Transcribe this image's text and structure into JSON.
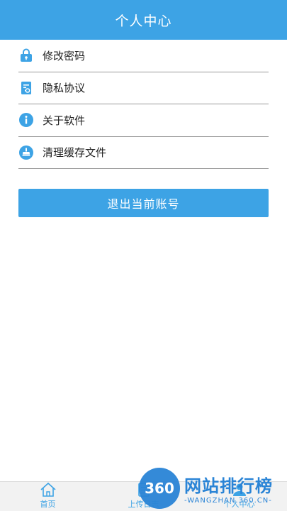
{
  "header": {
    "title": "个人中心"
  },
  "menu": {
    "items": [
      {
        "label": "修改密码",
        "icon": "lock-icon"
      },
      {
        "label": "隐私协议",
        "icon": "document-icon"
      },
      {
        "label": "关于软件",
        "icon": "info-icon"
      },
      {
        "label": "清理缓存文件",
        "icon": "broom-icon"
      }
    ]
  },
  "logout": {
    "label": "退出当前账号"
  },
  "tabbar": {
    "tabs": [
      {
        "label": "首页",
        "icon": "home-icon"
      },
      {
        "label": "上传日志",
        "icon": "log-icon"
      },
      {
        "label": "个人中心",
        "icon": "user-icon"
      }
    ]
  },
  "watermark": {
    "badge": "360",
    "title": "网站排行榜",
    "subtitle": "-WANGZHAN.360.CN-"
  },
  "colors": {
    "accent": "#3da3e5",
    "divider": "#9a9a9a"
  }
}
